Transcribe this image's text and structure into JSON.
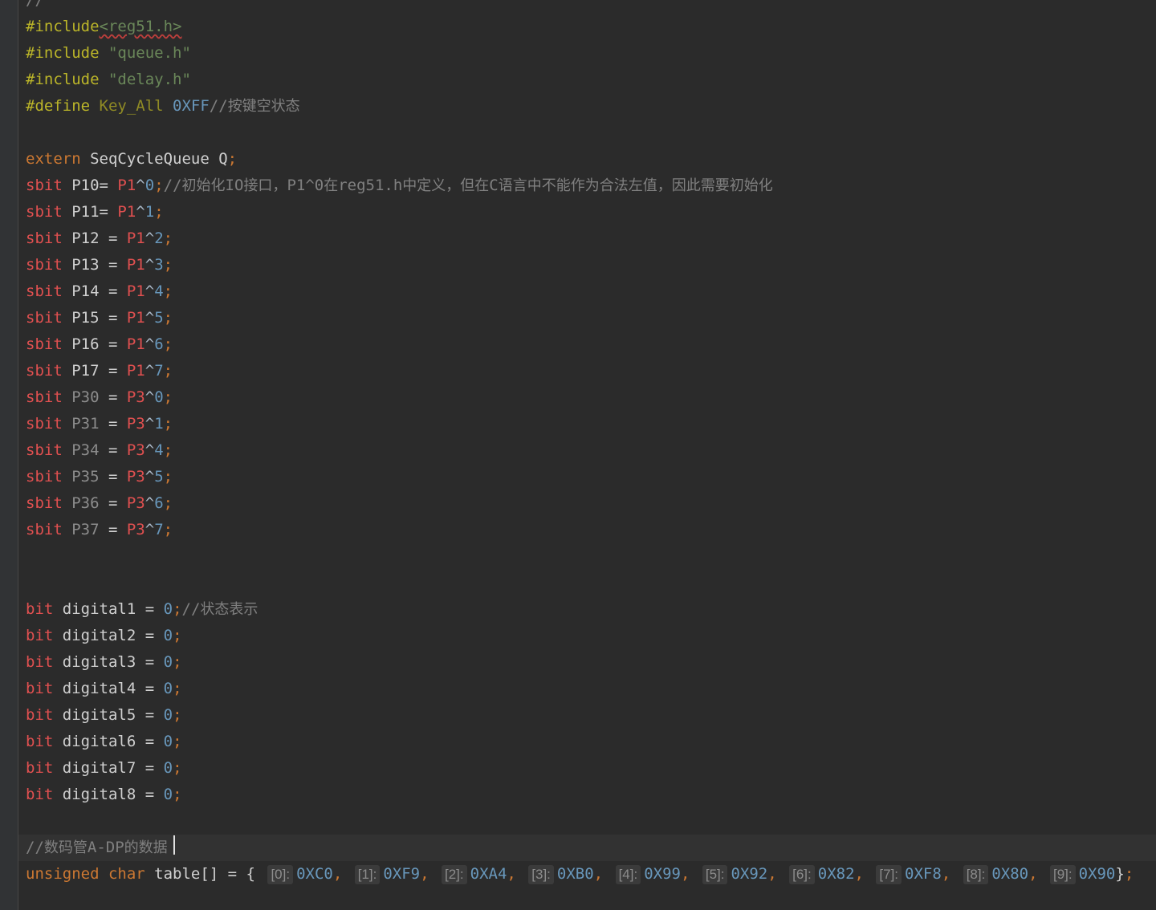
{
  "editor": {
    "language": "C",
    "gutter_color": "#313335",
    "background": "#2b2b2b",
    "lines": [
      {
        "t": [
          [
            "cm",
            "//"
          ]
        ]
      },
      {
        "t": [
          [
            "pp",
            "#include"
          ],
          [
            "hdr-sq",
            "<reg51.h>"
          ]
        ]
      },
      {
        "t": [
          [
            "pp",
            "#include "
          ],
          [
            "str",
            "\"queue.h\""
          ]
        ]
      },
      {
        "t": [
          [
            "pp",
            "#include "
          ],
          [
            "str",
            "\"delay.h\""
          ]
        ]
      },
      {
        "t": [
          [
            "pp",
            "#define "
          ],
          [
            "macro",
            "Key_All "
          ],
          [
            "num",
            "0XFF"
          ],
          [
            "cm",
            "//"
          ],
          [
            "cmcjk",
            "按键空状态"
          ]
        ]
      },
      {
        "t": []
      },
      {
        "t": [
          [
            "kw",
            "extern "
          ],
          [
            "id",
            "SeqCycleQueue Q"
          ],
          [
            "punc",
            ";"
          ]
        ]
      },
      {
        "t": [
          [
            "sbit",
            "sbit "
          ],
          [
            "id",
            "P10= "
          ],
          [
            "reg",
            "P1"
          ],
          [
            "op",
            "^"
          ],
          [
            "num",
            "0"
          ],
          [
            "punc",
            ";"
          ],
          [
            "cm",
            "//"
          ],
          [
            "cmcjk",
            "初始化"
          ],
          [
            "cm",
            "IO"
          ],
          [
            "cmcjk",
            "接口，"
          ],
          [
            "cm",
            "P1^0"
          ],
          [
            "cmcjk",
            "在"
          ],
          [
            "cm",
            "reg51.h"
          ],
          [
            "cmcjk",
            "中定义，但在"
          ],
          [
            "cm",
            "C"
          ],
          [
            "cmcjk",
            "语言中不能作为合法左值，因此需要初始化"
          ]
        ]
      },
      {
        "t": [
          [
            "sbit",
            "sbit "
          ],
          [
            "id",
            "P11= "
          ],
          [
            "reg",
            "P1"
          ],
          [
            "op",
            "^"
          ],
          [
            "num",
            "1"
          ],
          [
            "punc",
            ";"
          ]
        ]
      },
      {
        "t": [
          [
            "sbit",
            "sbit "
          ],
          [
            "id",
            "P12 = "
          ],
          [
            "reg",
            "P1"
          ],
          [
            "op",
            "^"
          ],
          [
            "num",
            "2"
          ],
          [
            "punc",
            ";"
          ]
        ]
      },
      {
        "t": [
          [
            "sbit",
            "sbit "
          ],
          [
            "id",
            "P13 = "
          ],
          [
            "reg",
            "P1"
          ],
          [
            "op",
            "^"
          ],
          [
            "num",
            "3"
          ],
          [
            "punc",
            ";"
          ]
        ]
      },
      {
        "t": [
          [
            "sbit",
            "sbit "
          ],
          [
            "id",
            "P14 = "
          ],
          [
            "reg",
            "P1"
          ],
          [
            "op",
            "^"
          ],
          [
            "num",
            "4"
          ],
          [
            "punc",
            ";"
          ]
        ]
      },
      {
        "t": [
          [
            "sbit",
            "sbit "
          ],
          [
            "id",
            "P15 = "
          ],
          [
            "reg",
            "P1"
          ],
          [
            "op",
            "^"
          ],
          [
            "num",
            "5"
          ],
          [
            "punc",
            ";"
          ]
        ]
      },
      {
        "t": [
          [
            "sbit",
            "sbit "
          ],
          [
            "id",
            "P16 = "
          ],
          [
            "reg",
            "P1"
          ],
          [
            "op",
            "^"
          ],
          [
            "num",
            "6"
          ],
          [
            "punc",
            ";"
          ]
        ]
      },
      {
        "t": [
          [
            "sbit",
            "sbit "
          ],
          [
            "id",
            "P17 = "
          ],
          [
            "reg",
            "P1"
          ],
          [
            "op",
            "^"
          ],
          [
            "num",
            "7"
          ],
          [
            "punc",
            ";"
          ]
        ]
      },
      {
        "t": [
          [
            "sbit",
            "sbit "
          ],
          [
            "unused",
            "P30"
          ],
          [
            "id",
            " = "
          ],
          [
            "reg",
            "P3"
          ],
          [
            "op",
            "^"
          ],
          [
            "num",
            "0"
          ],
          [
            "punc",
            ";"
          ]
        ]
      },
      {
        "t": [
          [
            "sbit",
            "sbit "
          ],
          [
            "unused",
            "P31"
          ],
          [
            "id",
            " = "
          ],
          [
            "reg",
            "P3"
          ],
          [
            "op",
            "^"
          ],
          [
            "num",
            "1"
          ],
          [
            "punc",
            ";"
          ]
        ]
      },
      {
        "t": [
          [
            "sbit",
            "sbit "
          ],
          [
            "unused",
            "P34"
          ],
          [
            "id",
            " = "
          ],
          [
            "reg",
            "P3"
          ],
          [
            "op",
            "^"
          ],
          [
            "num",
            "4"
          ],
          [
            "punc",
            ";"
          ]
        ]
      },
      {
        "t": [
          [
            "sbit",
            "sbit "
          ],
          [
            "unused",
            "P35"
          ],
          [
            "id",
            " = "
          ],
          [
            "reg",
            "P3"
          ],
          [
            "op",
            "^"
          ],
          [
            "num",
            "5"
          ],
          [
            "punc",
            ";"
          ]
        ]
      },
      {
        "t": [
          [
            "sbit",
            "sbit "
          ],
          [
            "unused",
            "P36"
          ],
          [
            "id",
            " = "
          ],
          [
            "reg",
            "P3"
          ],
          [
            "op",
            "^"
          ],
          [
            "num",
            "6"
          ],
          [
            "punc",
            ";"
          ]
        ]
      },
      {
        "t": [
          [
            "sbit",
            "sbit "
          ],
          [
            "unused",
            "P37"
          ],
          [
            "id",
            " = "
          ],
          [
            "reg",
            "P3"
          ],
          [
            "op",
            "^"
          ],
          [
            "num",
            "7"
          ],
          [
            "punc",
            ";"
          ]
        ]
      },
      {
        "t": []
      },
      {
        "t": []
      },
      {
        "t": [
          [
            "sbit",
            "bit "
          ],
          [
            "id",
            "digital1 = "
          ],
          [
            "num",
            "0"
          ],
          [
            "punc",
            ";"
          ],
          [
            "cm",
            "//"
          ],
          [
            "cmcjk",
            "状态表示"
          ]
        ]
      },
      {
        "t": [
          [
            "sbit",
            "bit "
          ],
          [
            "id",
            "digital2 = "
          ],
          [
            "num",
            "0"
          ],
          [
            "punc",
            ";"
          ]
        ]
      },
      {
        "t": [
          [
            "sbit",
            "bit "
          ],
          [
            "id",
            "digital3 = "
          ],
          [
            "num",
            "0"
          ],
          [
            "punc",
            ";"
          ]
        ]
      },
      {
        "t": [
          [
            "sbit",
            "bit "
          ],
          [
            "id",
            "digital4 = "
          ],
          [
            "num",
            "0"
          ],
          [
            "punc",
            ";"
          ]
        ]
      },
      {
        "t": [
          [
            "sbit",
            "bit "
          ],
          [
            "id",
            "digital5 = "
          ],
          [
            "num",
            "0"
          ],
          [
            "punc",
            ";"
          ]
        ]
      },
      {
        "t": [
          [
            "sbit",
            "bit "
          ],
          [
            "id",
            "digital6 = "
          ],
          [
            "num",
            "0"
          ],
          [
            "punc",
            ";"
          ]
        ]
      },
      {
        "t": [
          [
            "sbit",
            "bit "
          ],
          [
            "id",
            "digital7 = "
          ],
          [
            "num",
            "0"
          ],
          [
            "punc",
            ";"
          ]
        ]
      },
      {
        "t": [
          [
            "sbit",
            "bit "
          ],
          [
            "id",
            "digital8 = "
          ],
          [
            "num",
            "0"
          ],
          [
            "punc",
            ";"
          ]
        ]
      },
      {
        "t": []
      },
      {
        "current": true,
        "t": [
          [
            "cm",
            "//"
          ],
          [
            "cmcjk",
            "数码管"
          ],
          [
            "cm",
            "A-DP"
          ],
          [
            "cmcjk",
            "的数据"
          ]
        ]
      },
      {
        "t": [
          [
            "kw",
            "unsigned char "
          ],
          [
            "id",
            "table[] = { "
          ],
          [
            "hint",
            "[0]:"
          ],
          [
            "num",
            "0XC0"
          ],
          [
            "punc",
            ", "
          ],
          [
            "hint",
            "[1]:"
          ],
          [
            "num",
            "0XF9"
          ],
          [
            "punc",
            ", "
          ],
          [
            "hint",
            "[2]:"
          ],
          [
            "num",
            "0XA4"
          ],
          [
            "punc",
            ", "
          ],
          [
            "hint",
            "[3]:"
          ],
          [
            "num",
            "0XB0"
          ],
          [
            "punc",
            ", "
          ],
          [
            "hint",
            "[4]:"
          ],
          [
            "num",
            "0X99"
          ],
          [
            "punc",
            ", "
          ],
          [
            "hint",
            "[5]:"
          ],
          [
            "num",
            "0X92"
          ],
          [
            "punc",
            ", "
          ],
          [
            "hint",
            "[6]:"
          ],
          [
            "num",
            "0X82"
          ],
          [
            "punc",
            ", "
          ],
          [
            "hint",
            "[7]:"
          ],
          [
            "num",
            "0XF8"
          ],
          [
            "punc",
            ", "
          ],
          [
            "hint",
            "[8]:"
          ],
          [
            "num",
            "0X80"
          ],
          [
            "punc",
            ", "
          ],
          [
            "hint",
            "[9]:"
          ],
          [
            "num",
            "0X90"
          ],
          [
            "id",
            "}"
          ],
          [
            "punc",
            ";"
          ]
        ]
      }
    ]
  }
}
